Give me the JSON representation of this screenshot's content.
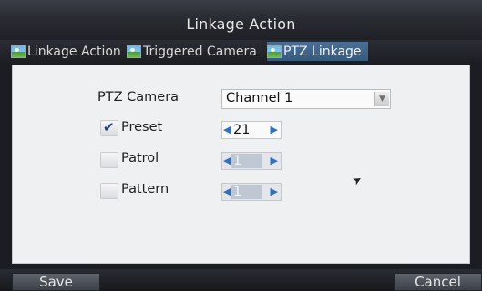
{
  "dialog": {
    "title": "Linkage Action"
  },
  "tabs": [
    {
      "label": "Linkage Action",
      "icon": "picture-icon",
      "active": false
    },
    {
      "label": "Triggered Camera",
      "icon": "picture-icon",
      "active": false
    },
    {
      "label": "PTZ Linkage",
      "icon": "picture-icon",
      "active": true
    }
  ],
  "form": {
    "ptz_camera_label": "PTZ Camera",
    "ptz_camera_value": "Channel 1",
    "preset": {
      "label": "Preset",
      "checked": true,
      "value": "21"
    },
    "patrol": {
      "label": "Patrol",
      "checked": false,
      "value": "1"
    },
    "pattern": {
      "label": "Pattern",
      "checked": false,
      "value": "1"
    }
  },
  "buttons": {
    "save_label": "Save",
    "cancel_label": "Cancel"
  },
  "colors": {
    "accent": "#2e71c9",
    "active_tab": "#4b6e95"
  }
}
